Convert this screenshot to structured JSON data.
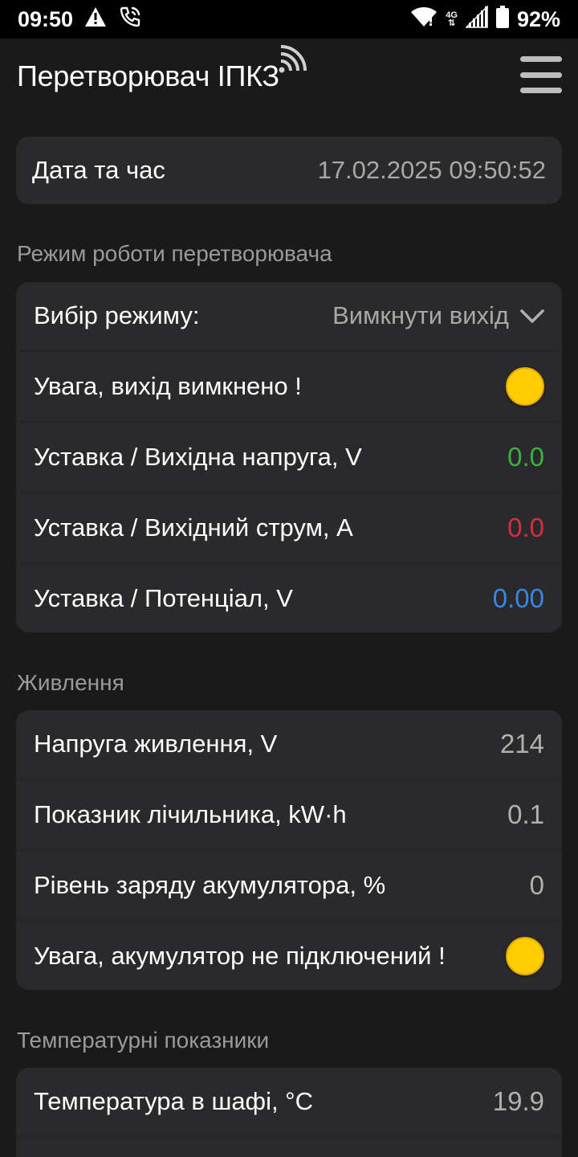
{
  "status_bar": {
    "time": "09:50",
    "network": "4G",
    "battery": "92%",
    "icons": [
      "warning-icon",
      "phone-wifi-call-icon",
      "wifi-icon",
      "network-4g-icon",
      "signal-icon",
      "battery-icon"
    ]
  },
  "app": {
    "title": "Перетворювач ІПКЗ",
    "connection_icon": "wireless-signal-icon",
    "menu_icon": "hamburger-menu-icon"
  },
  "datetime": {
    "label": "Дата та час",
    "value": "17.02.2025 09:50:52"
  },
  "mode_section": {
    "title": "Режим роботи перетворювача",
    "select_label": "Вибір режиму:",
    "select_value": "Вимкнути вихід",
    "warning_label": "Увага, вихід вимкнено !",
    "warning_color": "#ffcc00",
    "rows": [
      {
        "label": "Уставка / Вихідна напруга, V",
        "value": "0.0",
        "color": "#3cb043"
      },
      {
        "label": "Уставка / Вихідний струм, A",
        "value": "0.0",
        "color": "#d32f3f"
      },
      {
        "label": "Уставка / Потенціал, V",
        "value": "0.00",
        "color": "#3a86e0"
      }
    ]
  },
  "power_section": {
    "title": "Живлення",
    "rows": [
      {
        "label": "Напруга живлення, V",
        "value": "214"
      },
      {
        "label": "Показник лічильника, kW·h",
        "value": "0.1"
      },
      {
        "label": "Рівень заряду акумулятора, %",
        "value": "0"
      }
    ],
    "warning_label": "Увага, акумулятор не підключений !"
  },
  "temp_section": {
    "title": "Температурні показники",
    "rows": [
      {
        "label": "Температура в шафі, °C",
        "value": "19.9"
      }
    ]
  }
}
